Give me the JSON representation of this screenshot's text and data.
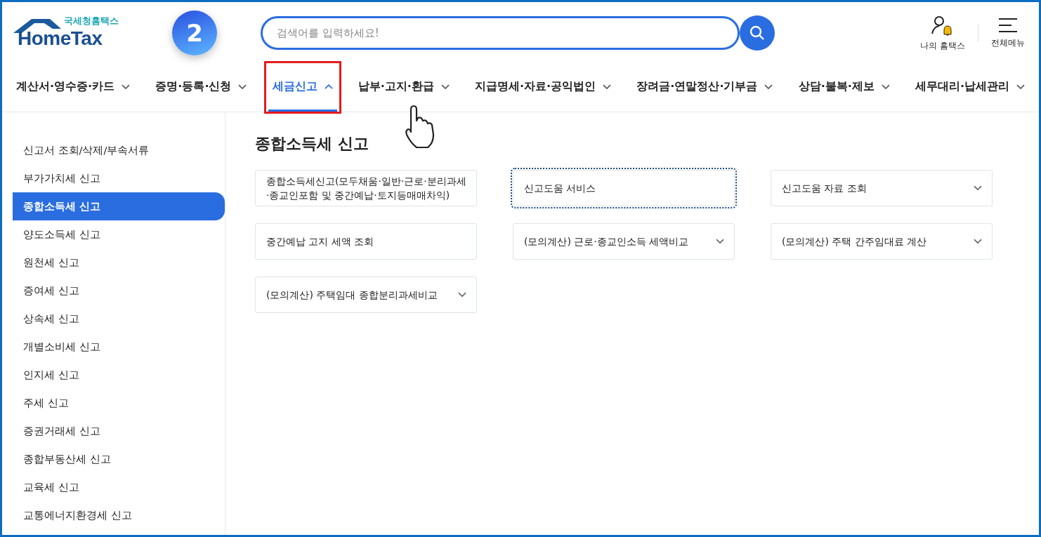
{
  "logo": {
    "subtitle": "국세청홈택스",
    "title": "HomeTax"
  },
  "step_badge": "2",
  "search": {
    "placeholder": "검색어를 입력하세요!"
  },
  "header_links": [
    {
      "kind": "user",
      "label": "나의 홈택스"
    },
    {
      "kind": "menu",
      "label": "전체메뉴"
    }
  ],
  "nav": [
    {
      "label": "계산서·영수증·카드",
      "selected": false
    },
    {
      "label": "증명·등록·신청",
      "selected": false
    },
    {
      "label": "세금신고",
      "selected": true
    },
    {
      "label": "납부·고지·환급",
      "selected": false
    },
    {
      "label": "지급명세·자료·공익법인",
      "selected": false
    },
    {
      "label": "장려금·연말정산·기부금",
      "selected": false
    },
    {
      "label": "상담·불복·제보",
      "selected": false
    },
    {
      "label": "세무대리·납세관리",
      "selected": false
    }
  ],
  "sidebar": {
    "items": [
      {
        "label": "신고서 조회/삭제/부속서류",
        "selected": false
      },
      {
        "label": "부가가치세 신고",
        "selected": false
      },
      {
        "label": "종합소득세 신고",
        "selected": true
      },
      {
        "label": "양도소득세 신고",
        "selected": false
      },
      {
        "label": "원천세 신고",
        "selected": false
      },
      {
        "label": "증여세 신고",
        "selected": false
      },
      {
        "label": "상속세 신고",
        "selected": false
      },
      {
        "label": "개별소비세 신고",
        "selected": false
      },
      {
        "label": "인지세 신고",
        "selected": false
      },
      {
        "label": "주세 신고",
        "selected": false
      },
      {
        "label": "증권거래세 신고",
        "selected": false
      },
      {
        "label": "종합부동산세 신고",
        "selected": false
      },
      {
        "label": "교육세 신고",
        "selected": false
      },
      {
        "label": "교통에너지환경세 신고",
        "selected": false
      }
    ]
  },
  "content": {
    "heading": "종합소득세 신고",
    "cards": [
      {
        "label": "종합소득세신고(모두채움·일반·근로·분리과세·종교인포함 및 중간예납·토지등매매차익)",
        "kind": "link",
        "focused": false
      },
      {
        "label": "신고도움 서비스",
        "kind": "link",
        "focused": true
      },
      {
        "label": "신고도움 자료 조회",
        "kind": "dropdown",
        "focused": false
      },
      {
        "label": "중간예납 고지 세액 조회",
        "kind": "link",
        "focused": false
      },
      {
        "label": "(모의계산) 근로·종교인소득 세액비교",
        "kind": "dropdown",
        "focused": false
      },
      {
        "label": "(모의계산) 주택 간주임대료 계산",
        "kind": "dropdown",
        "focused": false
      },
      {
        "label": "(모의계산) 주택임대 종합분리과세비교",
        "kind": "dropdown",
        "focused": false
      }
    ]
  }
}
